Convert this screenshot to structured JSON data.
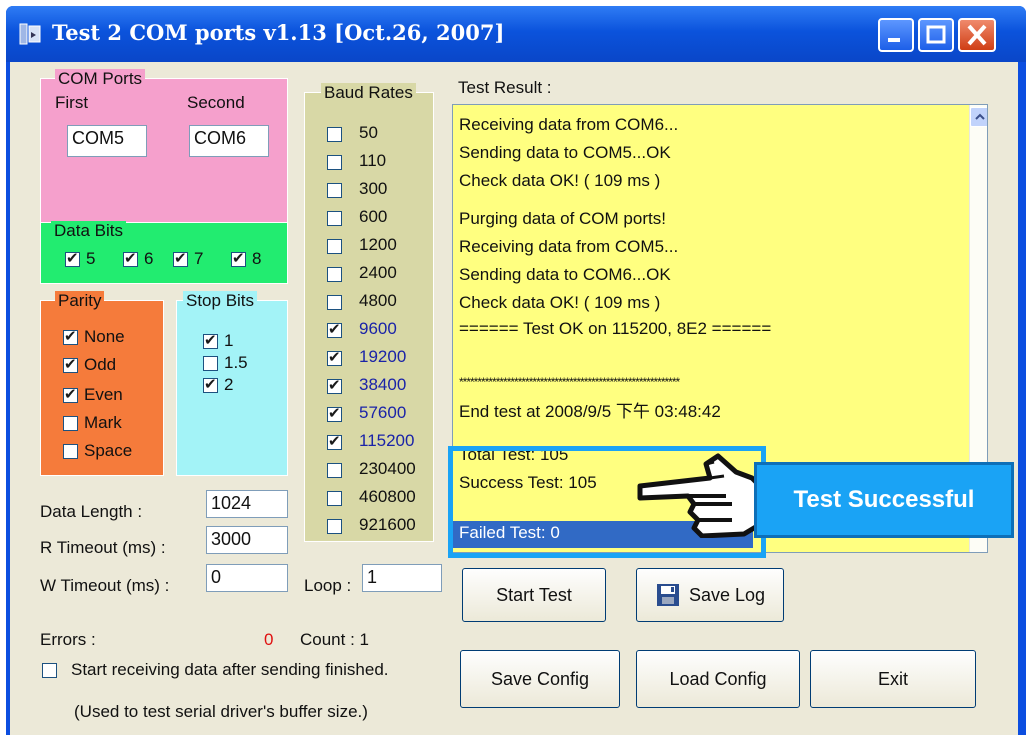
{
  "window": {
    "title": "Test 2 COM ports v1.13 [Oct.26, 2007]"
  },
  "com_ports": {
    "label": "COM Ports",
    "first_label": "First",
    "second_label": "Second",
    "first_value": "COM5",
    "second_value": "COM6"
  },
  "data_bits": {
    "label": "Data Bits",
    "items": [
      {
        "label": "5",
        "checked": true
      },
      {
        "label": "6",
        "checked": true
      },
      {
        "label": "7",
        "checked": true
      },
      {
        "label": "8",
        "checked": true
      }
    ]
  },
  "parity": {
    "label": "Parity",
    "items": [
      {
        "label": "None",
        "checked": true
      },
      {
        "label": "Odd",
        "checked": true
      },
      {
        "label": "Even",
        "checked": true
      },
      {
        "label": "Mark",
        "checked": false
      },
      {
        "label": "Space",
        "checked": false
      }
    ]
  },
  "stop_bits": {
    "label": "Stop Bits",
    "items": [
      {
        "label": "1",
        "checked": true
      },
      {
        "label": "1.5",
        "checked": false
      },
      {
        "label": "2",
        "checked": true
      }
    ]
  },
  "baud_rates": {
    "label": "Baud Rates",
    "items": [
      {
        "label": "50",
        "checked": false
      },
      {
        "label": "110",
        "checked": false
      },
      {
        "label": "300",
        "checked": false
      },
      {
        "label": "600",
        "checked": false
      },
      {
        "label": "1200",
        "checked": false
      },
      {
        "label": "2400",
        "checked": false
      },
      {
        "label": "4800",
        "checked": false
      },
      {
        "label": "9600",
        "checked": true
      },
      {
        "label": "19200",
        "checked": true
      },
      {
        "label": "38400",
        "checked": true
      },
      {
        "label": "57600",
        "checked": true
      },
      {
        "label": "115200",
        "checked": true
      },
      {
        "label": "230400",
        "checked": false
      },
      {
        "label": "460800",
        "checked": false
      },
      {
        "label": "921600",
        "checked": false
      }
    ]
  },
  "settings": {
    "data_length_label": "Data Length :",
    "data_length_value": "1024",
    "r_timeout_label": "R Timeout (ms) :",
    "r_timeout_value": "3000",
    "w_timeout_label": "W Timeout (ms) :",
    "w_timeout_value": "0",
    "loop_label": "Loop :",
    "loop_value": "1",
    "errors_label": "Errors :",
    "errors_value": "0",
    "count_text": "Count : 1",
    "start_after_label": "Start receiving data after sending finished.",
    "start_after_checked": false,
    "note": "(Used to test serial driver's buffer size.)",
    "error_color": "#e01010"
  },
  "test_result": {
    "label": "Test Result :",
    "lines": [
      "Receiving data from COM6...",
      "Sending data to COM5...OK",
      "Check data OK! ( 109 ms )",
      "",
      "Purging data of COM ports!",
      "Receiving data from COM5...",
      "Sending data to COM6...OK",
      "Check data OK! ( 109 ms )",
      "====== Test OK on 115200, 8E2 ======",
      "",
      "************************************************************",
      "End test at 2008/9/5 下午 03:48:42",
      "",
      "Total Test: 105",
      "Success Test: 105",
      "Failed Test: 0"
    ],
    "selected_line": "Failed Test: 0"
  },
  "buttons": {
    "start_test": "Start Test",
    "save_log": "Save Log",
    "save_config": "Save Config",
    "load_config": "Load Config",
    "exit": "Exit"
  },
  "annotation": {
    "callout": "Test Successful",
    "callout_color": "#1aa3f5"
  },
  "colors": {
    "com_ports_bg": "#f5a0cc",
    "data_bits_bg": "#22ec70",
    "parity_bg": "#f57b3b",
    "stop_bits_bg": "#a3f3f7",
    "baud_rates_bg": "#d8d8a6",
    "result_bg": "#ffff80",
    "selection": "#316ac5"
  }
}
